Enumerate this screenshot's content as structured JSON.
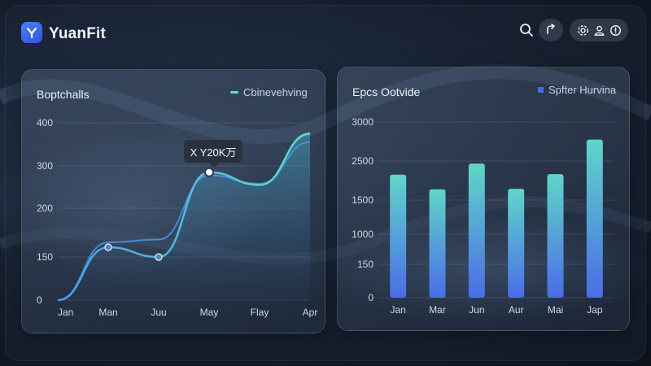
{
  "app": {
    "name": "YuanFit"
  },
  "header": {
    "icons": [
      "search-icon",
      "share-icon",
      "settings-icon",
      "user-icon",
      "info-icon"
    ]
  },
  "left_card": {
    "title": "Boptchalls",
    "legend": "Cbinevehving",
    "tooltip": "X Y20K万"
  },
  "right_card": {
    "title": "Epcs Ootvide",
    "legend": "Spfter Hurvina"
  },
  "colors": {
    "line_accent": "#5ee0c4",
    "line_blue": "#4a9bf0",
    "bar_top": "#5fd6c8",
    "bar_bottom": "#4a6de8",
    "legend_square": "#3d6cf0"
  },
  "chart_data": [
    {
      "type": "line",
      "title": "Boptchalls",
      "categories": [
        "Jan",
        "Man",
        "Juu",
        "May",
        "Flay",
        "Apr"
      ],
      "y_ticks": [
        "0",
        "150",
        "200",
        "300",
        "400"
      ],
      "series": [
        {
          "name": "Cbinevehving",
          "values": [
            0,
            160,
            150,
            285,
            255,
            375
          ]
        }
      ],
      "secondary_curve": [
        0,
        165,
        168,
        278,
        258,
        355
      ],
      "highlight": {
        "category": "May",
        "label": "X Y20K万"
      },
      "grid": true,
      "legend": "top-right"
    },
    {
      "type": "bar",
      "title": "Epcs Ootvide",
      "categories": [
        "Jan",
        "Mar",
        "Jun",
        "Aur",
        "Mai",
        "Jap"
      ],
      "y_ticks": [
        "0",
        "150",
        "1000",
        "1500",
        "2500",
        "3000"
      ],
      "series": [
        {
          "name": "Spfter Hurvina",
          "values": [
            2100,
            1850,
            2290,
            1860,
            2110,
            2700
          ]
        }
      ],
      "grid": true,
      "legend": "top-right"
    }
  ]
}
